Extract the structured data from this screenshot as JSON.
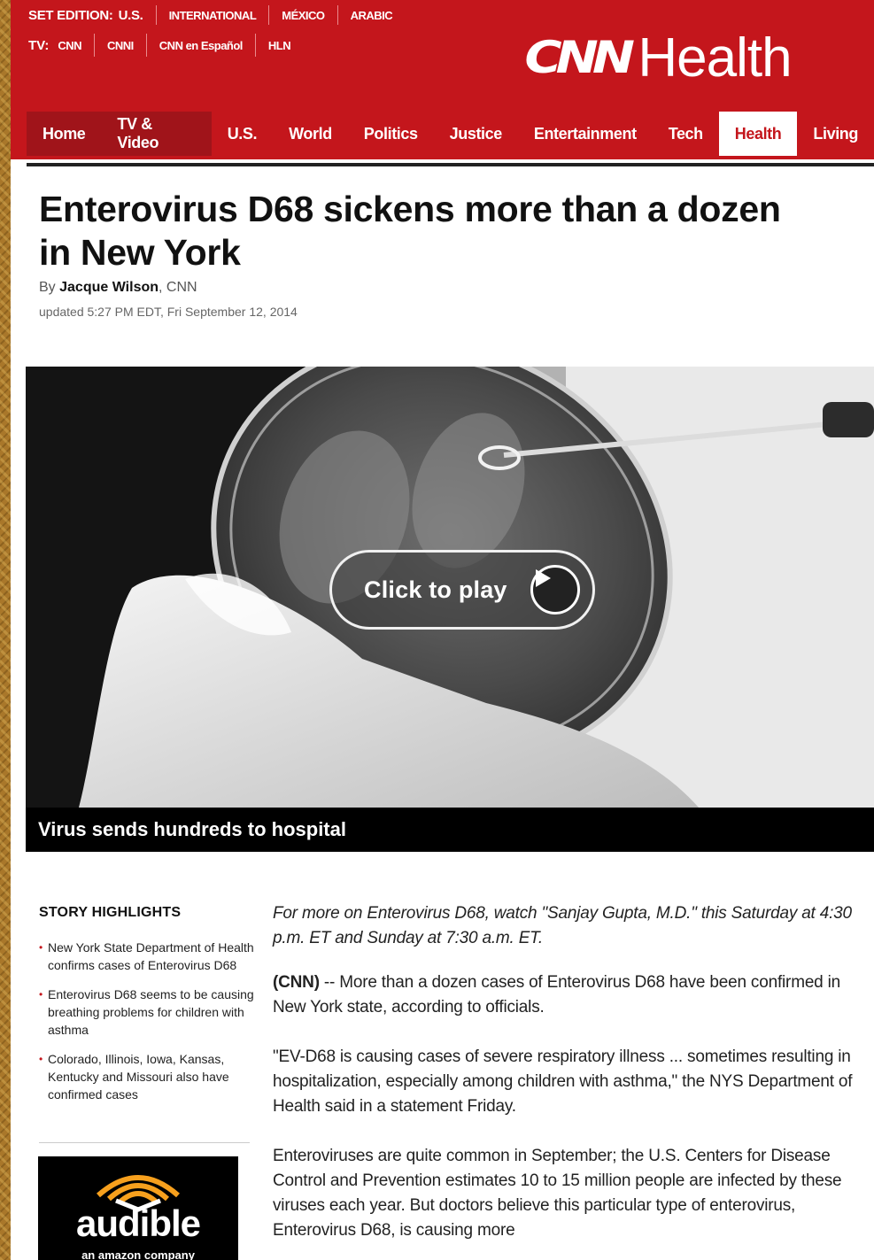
{
  "header": {
    "edition_label": "SET EDITION:",
    "edition_current": "U.S.",
    "editions": [
      "INTERNATIONAL",
      "MÉXICO",
      "ARABIC"
    ],
    "tv_label": "TV:",
    "tv_links": [
      "CNN",
      "CNNI",
      "CNN en Español",
      "HLN"
    ],
    "logo_cnn": "CNN",
    "logo_section": "Health",
    "brand_color": "#c4161c"
  },
  "nav": {
    "items": [
      "Home",
      "TV & Video",
      "U.S.",
      "World",
      "Politics",
      "Justice",
      "Entertainment",
      "Tech",
      "Health",
      "Living"
    ],
    "active": "Health"
  },
  "article": {
    "headline": "Enterovirus D68 sickens more than a dozen in New York",
    "by_prefix": "By",
    "author": "Jacque Wilson",
    "outlet": ", CNN",
    "updated": "updated 5:27 PM EDT, Fri September 12, 2014"
  },
  "video": {
    "play_label": "Click to play",
    "caption": "Virus sends hundreds to hospital",
    "play_icon": "play-icon"
  },
  "highlights": {
    "title": "STORY HIGHLIGHTS",
    "items": [
      "New York State Department of Health confirms cases of Enterovirus D68",
      "Enterovirus D68 seems to be causing breathing problems for children with asthma",
      "Colorado, Illinois, Iowa, Kansas, Kentucky and Missouri also have confirmed cases"
    ]
  },
  "ad": {
    "brand": "audible",
    "sub": "an amazon company"
  },
  "body": {
    "intro": "For more on Enterovirus D68, watch \"Sanjay Gupta, M.D.\" this Saturday at 4:30 p.m. ET and Sunday at 7:30 a.m. ET.",
    "p1_source": "(CNN)",
    "p1": " -- More than a dozen cases of Enterovirus D68 have been confirmed in New York state, according to officials.",
    "p2": "\"EV-D68 is causing cases of severe respiratory illness ... sometimes resulting in hospitalization, especially among children with asthma,\" the NYS Department of Health said in a statement Friday.",
    "p3": "Enteroviruses are quite common in September; the U.S. Centers for Disease Control and Prevention estimates 10 to 15 million people are infected by these viruses each year. But doctors believe this particular type of enterovirus, Enterovirus D68, is causing more"
  }
}
